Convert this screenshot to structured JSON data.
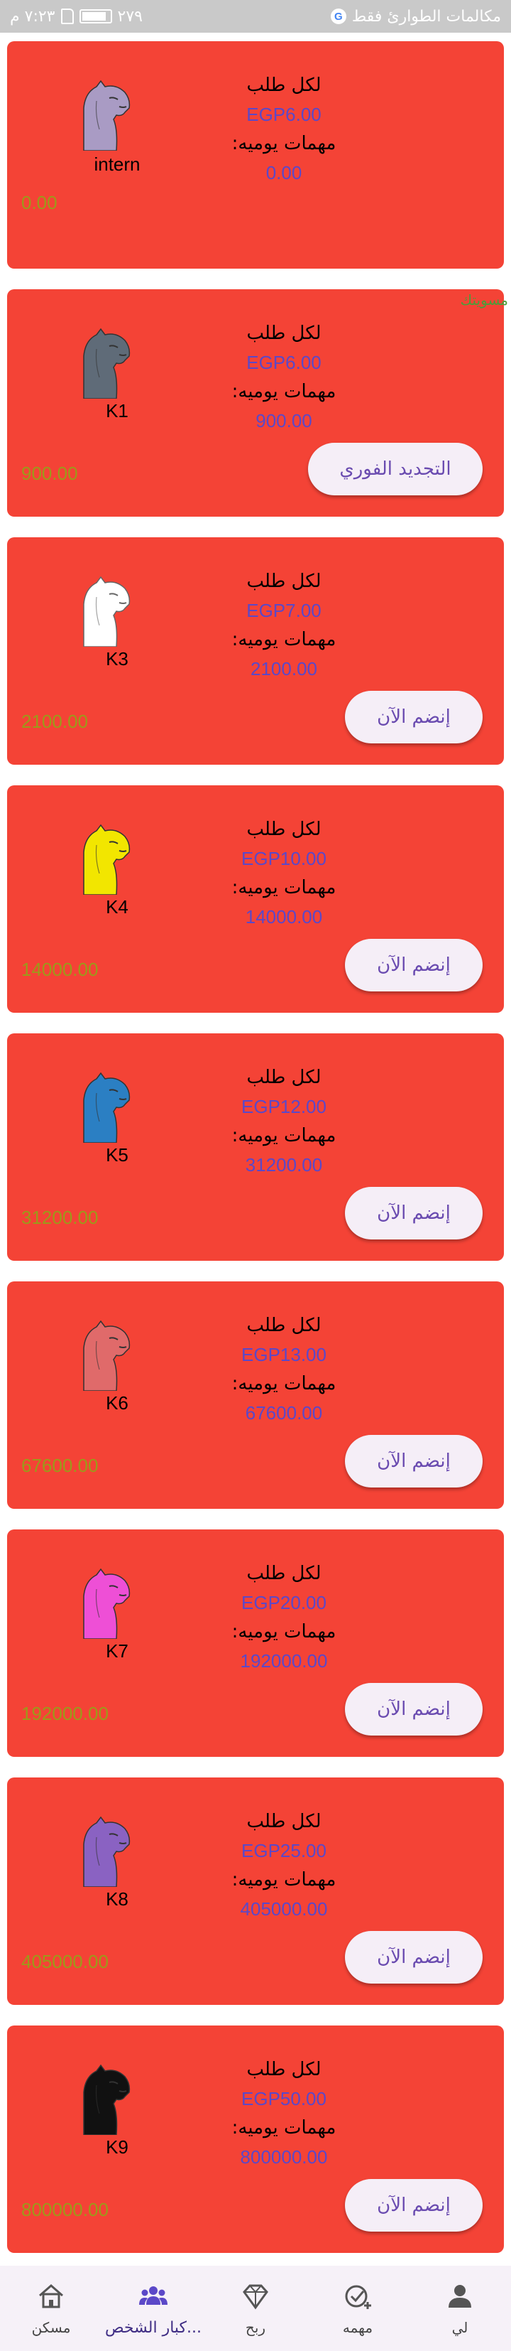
{
  "status_bar": {
    "time": "٧:٢٣ م",
    "battery_text": "٢٧٩",
    "battery_level": 0.79,
    "carrier_text": "مكالمات الطوارئ فقط"
  },
  "side_tag": "مسويتك",
  "per_order_label": "لكل طلب",
  "daily_tasks_label": "مهمات يوميه:",
  "levels": [
    {
      "name": "intern",
      "price": "EGP6.00",
      "daily_tasks": "0.00",
      "total": "0.00",
      "button": "",
      "color": "#a99bc4"
    },
    {
      "name": "K1",
      "price": "EGP6.00",
      "daily_tasks": "900.00",
      "total": "900.00",
      "button": "التجديد الفوري",
      "color": "#5f6b78"
    },
    {
      "name": "K3",
      "price": "EGP7.00",
      "daily_tasks": "2100.00",
      "total": "2100.00",
      "button": "إنضم الآن",
      "color": "#ffffff"
    },
    {
      "name": "K4",
      "price": "EGP10.00",
      "daily_tasks": "14000.00",
      "total": "14000.00",
      "button": "إنضم الآن",
      "color": "#f2e600"
    },
    {
      "name": "K5",
      "price": "EGP12.00",
      "daily_tasks": "31200.00",
      "total": "31200.00",
      "button": "إنضم الآن",
      "color": "#2b7fc3"
    },
    {
      "name": "K6",
      "price": "EGP13.00",
      "daily_tasks": "67600.00",
      "total": "67600.00",
      "button": "إنضم الآن",
      "color": "#e06a6a"
    },
    {
      "name": "K7",
      "price": "EGP20.00",
      "daily_tasks": "192000.00",
      "total": "192000.00",
      "button": "إنضم الآن",
      "color": "#ee4fd6"
    },
    {
      "name": "K8",
      "price": "EGP25.00",
      "daily_tasks": "405000.00",
      "total": "405000.00",
      "button": "إنضم الآن",
      "color": "#8a62c2"
    },
    {
      "name": "K9",
      "price": "EGP50.00",
      "daily_tasks": "800000.00",
      "total": "800000.00",
      "button": "إنضم الآن",
      "color": "#111111"
    }
  ],
  "nav": [
    {
      "label": "مسكن",
      "icon": "home-icon",
      "active": false
    },
    {
      "label": "...كبار الشخص",
      "icon": "group-icon",
      "active": true
    },
    {
      "label": "ربح",
      "icon": "diamond-icon",
      "active": false
    },
    {
      "label": "مهمه",
      "icon": "task-check-icon",
      "active": false
    },
    {
      "label": "لي",
      "icon": "person-icon",
      "active": false
    }
  ],
  "colors": {
    "card": "#f44336",
    "value_text": "#5b48c8",
    "total_text": "#9c9a1a",
    "button_bg": "#f5eef7",
    "button_text": "#6a4bb0",
    "nav_active": "#5b48c8"
  }
}
